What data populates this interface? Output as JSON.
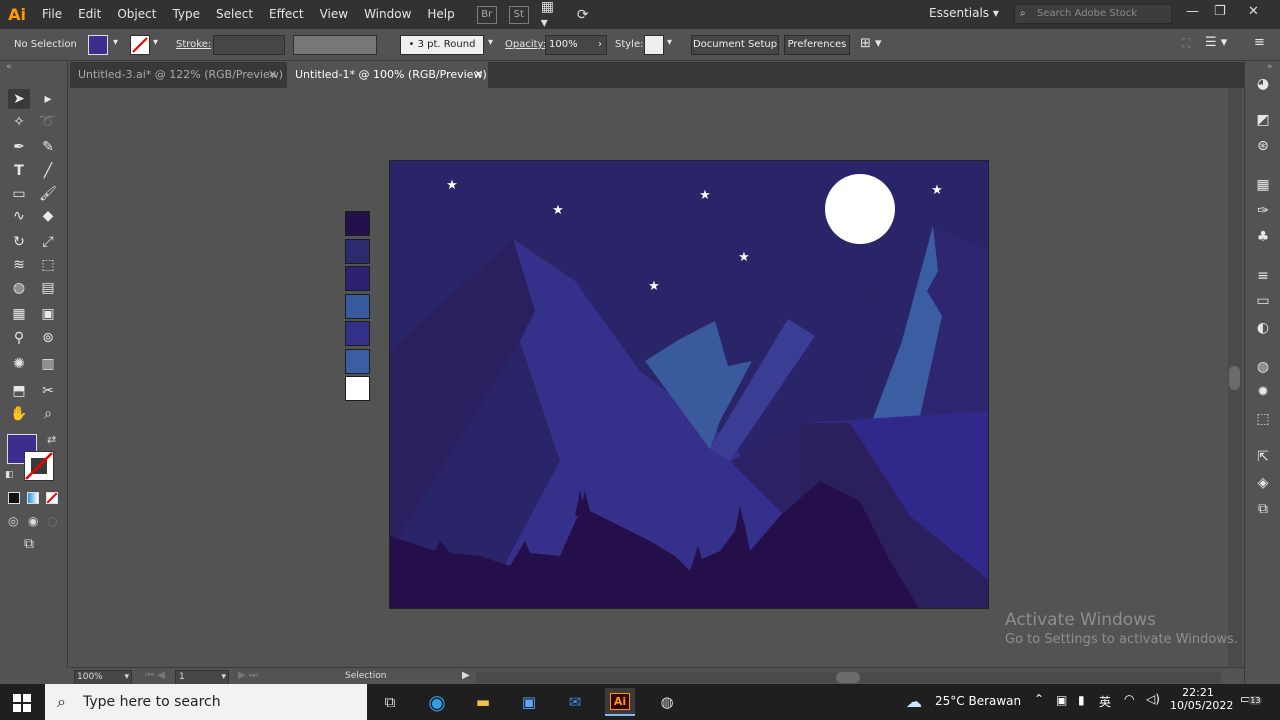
{
  "app": {
    "logo": "Ai"
  },
  "menu": [
    "File",
    "Edit",
    "Object",
    "Type",
    "Select",
    "Effect",
    "View",
    "Window",
    "Help"
  ],
  "topbar": {
    "br_icon": "Br",
    "st_icon": "St",
    "workspace": "Essentials",
    "search_placeholder": "Search Adobe Stock"
  },
  "control": {
    "selection": "No Selection",
    "stroke_label": "Stroke:",
    "brush": "3 pt. Round",
    "opacity_label": "Opacity:",
    "opacity": "100%",
    "style_label": "Style:",
    "doc_setup": "Document Setup",
    "preferences": "Preferences"
  },
  "tabs": [
    {
      "label": "Untitled-3.ai* @ 122% (RGB/Preview)",
      "active": false
    },
    {
      "label": "Untitled-1* @ 100% (RGB/Preview)",
      "active": true
    }
  ],
  "status": {
    "zoom": "100%",
    "page": "1",
    "mode": "Selection"
  },
  "swatches": [
    "#23104a",
    "#2e2a6e",
    "#2d2271",
    "#3a5aa0",
    "#33308a",
    "#3b5da2",
    "#ffffff"
  ],
  "colors": {
    "fill": "#3b2e8e",
    "stroke": "#ffffff"
  },
  "watermark": {
    "title": "Activate Windows",
    "sub": "Go to Settings to activate Windows."
  },
  "taskbar": {
    "search": "Type here to search",
    "weather": "25°C  Berawan",
    "time": "22:21",
    "date": "10/05/2022",
    "notif": "13"
  }
}
